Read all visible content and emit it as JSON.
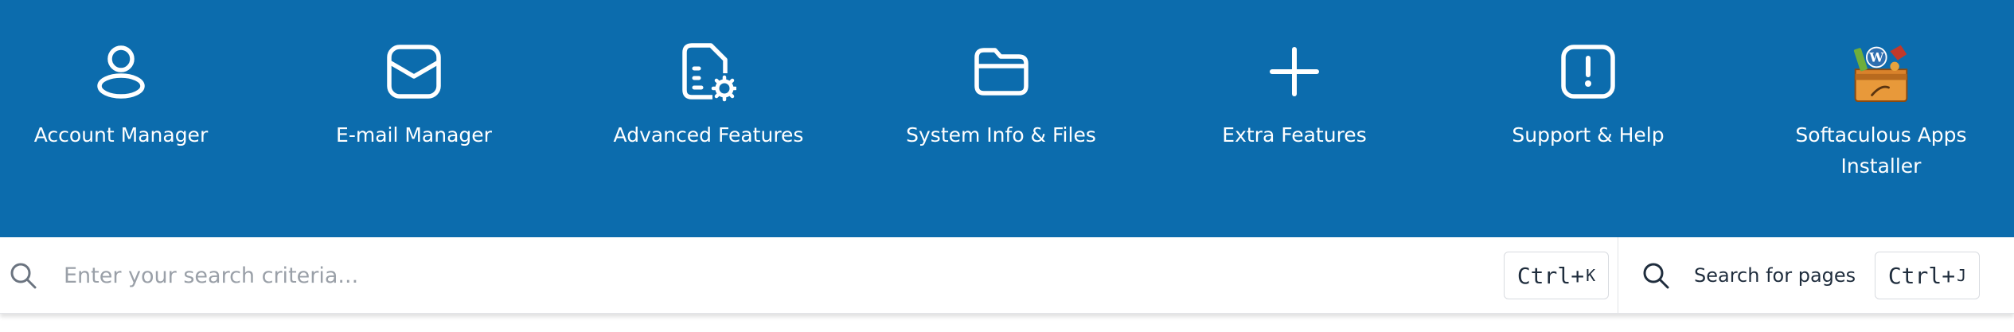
{
  "nav": {
    "items": [
      {
        "label": "Account Manager",
        "icon": "user-icon"
      },
      {
        "label": "E-mail Manager",
        "icon": "mail-icon"
      },
      {
        "label": "Advanced Features",
        "icon": "document-gear-icon"
      },
      {
        "label": "System Info & Files",
        "icon": "folder-icon"
      },
      {
        "label": "Extra Features",
        "icon": "plus-icon"
      },
      {
        "label": "Support & Help",
        "icon": "alert-icon"
      },
      {
        "label": "Softaculous Apps Installer",
        "icon": "softaculous-icon"
      }
    ]
  },
  "search": {
    "placeholder": "Enter your search criteria...",
    "shortcut_main": "Ctrl+",
    "shortcut_key": "K"
  },
  "page_search": {
    "label": "Search for pages",
    "shortcut_main": "Ctrl+",
    "shortcut_key": "J"
  },
  "colors": {
    "header_bg": "#0c6cad",
    "icon": "#ffffff",
    "placeholder": "#9aa0a8"
  }
}
